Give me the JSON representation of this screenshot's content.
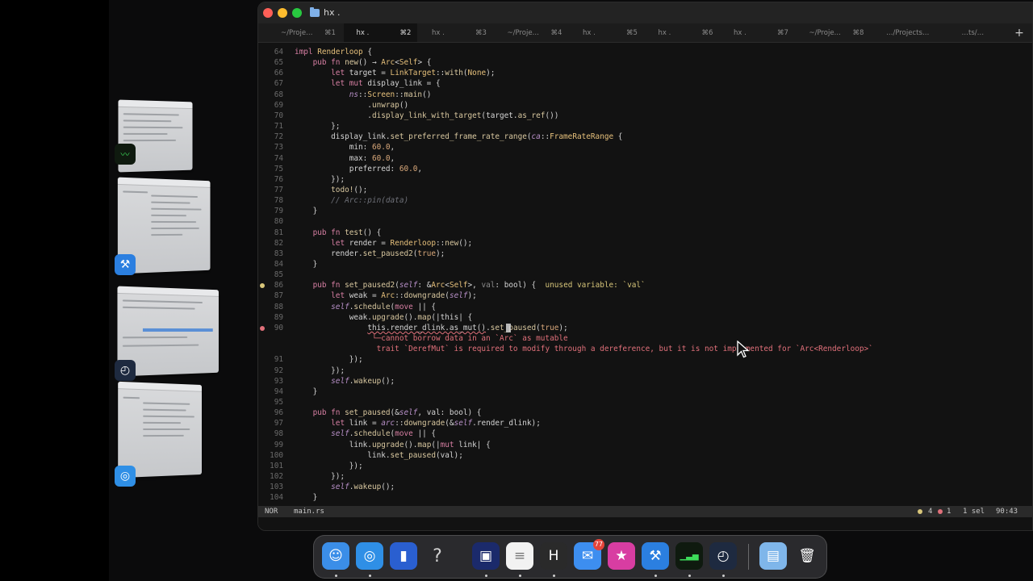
{
  "window": {
    "title": "hx ."
  },
  "tabs": [
    {
      "label": "~/Proje…",
      "key": "⌘1",
      "active": false
    },
    {
      "label": "hx .",
      "key": "⌘2",
      "active": true
    },
    {
      "label": "hx .",
      "key": "⌘3",
      "active": false
    },
    {
      "label": "~/Proje…",
      "key": "⌘4",
      "active": false
    },
    {
      "label": "hx .",
      "key": "⌘5",
      "active": false
    },
    {
      "label": "hx .",
      "key": "⌘6",
      "active": false
    },
    {
      "label": "hx .",
      "key": "⌘7",
      "active": false
    },
    {
      "label": "~/Proje…",
      "key": "⌘8",
      "active": false
    },
    {
      "label": "…/Projects…",
      "key": "",
      "active": false
    },
    {
      "label": "…ts/…",
      "key": "",
      "active": false
    }
  ],
  "tab_add_label": "+",
  "editor": {
    "lines": [
      {
        "n": "64",
        "code": [
          [
            "kw",
            "impl "
          ],
          [
            "ty",
            "Renderloop"
          ],
          [
            "pl",
            " {"
          ]
        ]
      },
      {
        "n": "65",
        "code": [
          [
            "pl",
            "    "
          ],
          [
            "kw",
            "pub fn "
          ],
          [
            "fn",
            "new"
          ],
          [
            "pl",
            "() → "
          ],
          [
            "ty",
            "Arc"
          ],
          [
            "pl",
            "<"
          ],
          [
            "ty",
            "Self"
          ],
          [
            "pl",
            "> {"
          ]
        ]
      },
      {
        "n": "66",
        "code": [
          [
            "pl",
            "        "
          ],
          [
            "kw",
            "let "
          ],
          [
            "pl",
            "target = "
          ],
          [
            "ty",
            "LinkTarget"
          ],
          [
            "pl",
            "::"
          ],
          [
            "fn",
            "with"
          ],
          [
            "pl",
            "("
          ],
          [
            "ty",
            "None"
          ],
          [
            "pl",
            ");"
          ]
        ]
      },
      {
        "n": "67",
        "code": [
          [
            "pl",
            "        "
          ],
          [
            "kw",
            "let mut "
          ],
          [
            "pl",
            "display_link = {"
          ]
        ]
      },
      {
        "n": "68",
        "code": [
          [
            "pl",
            "            "
          ],
          [
            "it",
            "ns"
          ],
          [
            "pl",
            "::"
          ],
          [
            "ty",
            "Screen"
          ],
          [
            "pl",
            "::"
          ],
          [
            "fn",
            "main"
          ],
          [
            "pl",
            "()"
          ]
        ]
      },
      {
        "n": "69",
        "code": [
          [
            "pl",
            "                ."
          ],
          [
            "fn",
            "unwrap"
          ],
          [
            "pl",
            "()"
          ]
        ]
      },
      {
        "n": "70",
        "code": [
          [
            "pl",
            "                ."
          ],
          [
            "fn",
            "display_link_with_target"
          ],
          [
            "pl",
            "(target."
          ],
          [
            "fn",
            "as_ref"
          ],
          [
            "pl",
            "())"
          ]
        ]
      },
      {
        "n": "71",
        "code": [
          [
            "pl",
            "        };"
          ]
        ]
      },
      {
        "n": "72",
        "code": [
          [
            "pl",
            "        display_link."
          ],
          [
            "fn",
            "set_preferred_frame_rate_range"
          ],
          [
            "pl",
            "("
          ],
          [
            "it",
            "ca"
          ],
          [
            "pl",
            "::"
          ],
          [
            "ty",
            "FrameRateRange"
          ],
          [
            "pl",
            " {"
          ]
        ]
      },
      {
        "n": "73",
        "code": [
          [
            "pl",
            "            min: "
          ],
          [
            "num",
            "60.0"
          ],
          [
            "pl",
            ","
          ]
        ]
      },
      {
        "n": "74",
        "code": [
          [
            "pl",
            "            max: "
          ],
          [
            "num",
            "60.0"
          ],
          [
            "pl",
            ","
          ]
        ]
      },
      {
        "n": "75",
        "code": [
          [
            "pl",
            "            preferred: "
          ],
          [
            "num",
            "60.0"
          ],
          [
            "pl",
            ","
          ]
        ]
      },
      {
        "n": "76",
        "code": [
          [
            "pl",
            "        });"
          ]
        ]
      },
      {
        "n": "77",
        "code": [
          [
            "pl",
            "        "
          ],
          [
            "fn",
            "todo!"
          ],
          [
            "pl",
            "();"
          ]
        ]
      },
      {
        "n": "78",
        "code": [
          [
            "pl",
            "        "
          ],
          [
            "cm",
            "// Arc::pin(data)"
          ]
        ]
      },
      {
        "n": "79",
        "code": [
          [
            "pl",
            "    }"
          ]
        ]
      },
      {
        "n": "80",
        "code": []
      },
      {
        "n": "81",
        "code": [
          [
            "pl",
            "    "
          ],
          [
            "kw",
            "pub fn "
          ],
          [
            "fn",
            "test"
          ],
          [
            "pl",
            "() {"
          ]
        ]
      },
      {
        "n": "82",
        "code": [
          [
            "pl",
            "        "
          ],
          [
            "kw",
            "let "
          ],
          [
            "pl",
            "render = "
          ],
          [
            "ty",
            "Renderloop"
          ],
          [
            "pl",
            "::"
          ],
          [
            "fn",
            "new"
          ],
          [
            "pl",
            "();"
          ]
        ]
      },
      {
        "n": "83",
        "code": [
          [
            "pl",
            "        render."
          ],
          [
            "fn",
            "set_paused2"
          ],
          [
            "pl",
            "("
          ],
          [
            "num",
            "true"
          ],
          [
            "pl",
            ");"
          ]
        ]
      },
      {
        "n": "84",
        "code": [
          [
            "pl",
            "    }"
          ]
        ]
      },
      {
        "n": "85",
        "code": []
      },
      {
        "n": "86",
        "code": [
          [
            "pl",
            "    "
          ],
          [
            "kw",
            "pub fn "
          ],
          [
            "fn",
            "set_paused2"
          ],
          [
            "pl",
            "("
          ],
          [
            "it",
            "self"
          ],
          [
            "pl",
            ": &"
          ],
          [
            "ty",
            "Arc"
          ],
          [
            "pl",
            "<"
          ],
          [
            "ty",
            "Self"
          ],
          [
            "pl",
            ">, "
          ],
          [
            "dim",
            "val"
          ],
          [
            "pl",
            ": bool) {  "
          ],
          [
            "warnt",
            "unused variable: `val`"
          ]
        ],
        "marker": "warning"
      },
      {
        "n": "87",
        "code": [
          [
            "pl",
            "        "
          ],
          [
            "kw",
            "let "
          ],
          [
            "pl",
            "weak = "
          ],
          [
            "ty",
            "Arc"
          ],
          [
            "pl",
            "::"
          ],
          [
            "fn",
            "downgrade"
          ],
          [
            "pl",
            "("
          ],
          [
            "it",
            "self"
          ],
          [
            "pl",
            ");"
          ]
        ]
      },
      {
        "n": "88",
        "code": [
          [
            "pl",
            "        "
          ],
          [
            "it",
            "self"
          ],
          [
            "pl",
            "."
          ],
          [
            "fn",
            "schedule"
          ],
          [
            "pl",
            "("
          ],
          [
            "kw",
            "move "
          ],
          [
            "pl",
            "|| {"
          ]
        ]
      },
      {
        "n": "89",
        "code": [
          [
            "pl",
            "            weak."
          ],
          [
            "fn",
            "upgrade"
          ],
          [
            "pl",
            "()."
          ],
          [
            "fn",
            "map"
          ],
          [
            "pl",
            "(|this| {"
          ]
        ]
      },
      {
        "n": "90",
        "code": [
          [
            "pl",
            "                "
          ],
          [
            "undl",
            "this.render_dlink.as_mut()"
          ],
          [
            "pl",
            "."
          ],
          [
            "fn",
            "set_paused"
          ],
          [
            "pl",
            "("
          ],
          [
            "num",
            "true"
          ],
          [
            "pl",
            ");"
          ]
        ],
        "marker": "error"
      },
      {
        "n": "",
        "code": [
          [
            "pl",
            "                 "
          ],
          [
            "errt",
            "└─cannot borrow data in an `Arc` as mutable"
          ]
        ]
      },
      {
        "n": "",
        "code": [
          [
            "pl",
            "                  "
          ],
          [
            "errt",
            "trait `DerefMut` is required to modify through a dereference, but it is not implemented for `Arc<Renderloop>`"
          ]
        ]
      },
      {
        "n": "91",
        "code": [
          [
            "pl",
            "            });"
          ]
        ]
      },
      {
        "n": "92",
        "code": [
          [
            "pl",
            "        });"
          ]
        ]
      },
      {
        "n": "93",
        "code": [
          [
            "pl",
            "        "
          ],
          [
            "it",
            "self"
          ],
          [
            "pl",
            "."
          ],
          [
            "fn",
            "wakeup"
          ],
          [
            "pl",
            "();"
          ]
        ]
      },
      {
        "n": "94",
        "code": [
          [
            "pl",
            "    }"
          ]
        ]
      },
      {
        "n": "95",
        "code": []
      },
      {
        "n": "96",
        "code": [
          [
            "pl",
            "    "
          ],
          [
            "kw",
            "pub fn "
          ],
          [
            "fn",
            "set_paused"
          ],
          [
            "pl",
            "(&"
          ],
          [
            "it",
            "self"
          ],
          [
            "pl",
            ", val: bool) {"
          ]
        ]
      },
      {
        "n": "97",
        "code": [
          [
            "pl",
            "        "
          ],
          [
            "kw",
            "let "
          ],
          [
            "pl",
            "link = "
          ],
          [
            "it",
            "arc"
          ],
          [
            "pl",
            "::"
          ],
          [
            "fn",
            "downgrade"
          ],
          [
            "pl",
            "(&"
          ],
          [
            "it",
            "self"
          ],
          [
            "pl",
            ".render_dlink);"
          ]
        ]
      },
      {
        "n": "98",
        "code": [
          [
            "pl",
            "        "
          ],
          [
            "it",
            "self"
          ],
          [
            "pl",
            "."
          ],
          [
            "fn",
            "schedule"
          ],
          [
            "pl",
            "("
          ],
          [
            "kw",
            "move "
          ],
          [
            "pl",
            "|| {"
          ]
        ]
      },
      {
        "n": "99",
        "code": [
          [
            "pl",
            "            link."
          ],
          [
            "fn",
            "upgrade"
          ],
          [
            "pl",
            "()."
          ],
          [
            "fn",
            "map"
          ],
          [
            "pl",
            "(|"
          ],
          [
            "kw",
            "mut "
          ],
          [
            "pl",
            "link| {"
          ]
        ]
      },
      {
        "n": "100",
        "code": [
          [
            "pl",
            "                link."
          ],
          [
            "fn",
            "set_paused"
          ],
          [
            "pl",
            "(val);"
          ]
        ]
      },
      {
        "n": "101",
        "code": [
          [
            "pl",
            "            });"
          ]
        ]
      },
      {
        "n": "102",
        "code": [
          [
            "pl",
            "        });"
          ]
        ]
      },
      {
        "n": "103",
        "code": [
          [
            "pl",
            "        "
          ],
          [
            "it",
            "self"
          ],
          [
            "pl",
            "."
          ],
          [
            "fn",
            "wakeup"
          ],
          [
            "pl",
            "();"
          ]
        ]
      },
      {
        "n": "104",
        "code": [
          [
            "pl",
            "    }"
          ]
        ]
      }
    ]
  },
  "statusline": {
    "mode": "NOR",
    "file": "main.rs",
    "warnings": "4",
    "errors": "1",
    "selection": "1 sel",
    "position": "90:43"
  },
  "colors": {
    "warning": "#d8c67a",
    "error": "#e0707a",
    "background": "#121212"
  },
  "dock": {
    "items": [
      {
        "name": "finder-icon",
        "glyph": "☺",
        "bg": "#3b8ee8"
      },
      {
        "name": "safari-icon",
        "glyph": "◎",
        "bg": "#2f8fe6"
      },
      {
        "name": "app-icon",
        "glyph": "▮",
        "bg": "#2a5fd0"
      },
      {
        "name": "help-icon",
        "glyph": "?",
        "bg": "transparent"
      },
      {
        "name": "terminal-icon",
        "glyph": "▣",
        "bg": "#1b2a6b"
      },
      {
        "name": "notes-icon",
        "glyph": "≡",
        "bg": "#f2f2f2"
      },
      {
        "name": "helix-icon",
        "glyph": "H",
        "bg": "#2a2a2a"
      },
      {
        "name": "mail-icon",
        "glyph": "✉",
        "bg": "#3d8ef0",
        "badge": "77"
      },
      {
        "name": "star-icon",
        "glyph": "★",
        "bg": "#d83da2"
      },
      {
        "name": "xcode-icon",
        "glyph": "⚒",
        "bg": "#2b7fe0"
      },
      {
        "name": "activity-monitor-icon",
        "glyph": "▁▃▅",
        "bg": "#0f1a0f"
      },
      {
        "name": "instruments-icon",
        "glyph": "◴",
        "bg": "#1e2a40"
      },
      {
        "name": "downloads-folder-icon",
        "glyph": "▤",
        "bg": "#7fb6ea"
      },
      {
        "name": "trash-icon",
        "glyph": "🗑",
        "bg": "transparent"
      }
    ]
  },
  "stage_manager": {
    "windows": [
      {
        "name": "stage-window-activity-monitor",
        "icon": "activity-monitor-icon"
      },
      {
        "name": "stage-window-xcode",
        "icon": "xcode-icon"
      },
      {
        "name": "stage-window-instruments",
        "icon": "instruments-icon"
      },
      {
        "name": "stage-window-safari",
        "icon": "safari-icon"
      }
    ]
  }
}
